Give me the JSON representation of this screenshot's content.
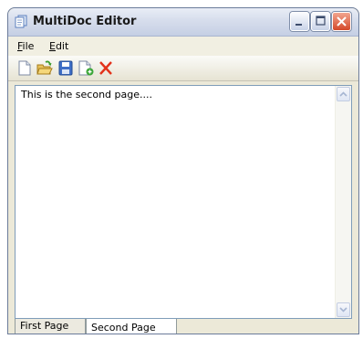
{
  "window": {
    "title": "MultiDoc Editor"
  },
  "menu": {
    "items": [
      {
        "mnemonic": "F",
        "rest": "ile"
      },
      {
        "mnemonic": "E",
        "rest": "dit"
      }
    ]
  },
  "toolbar": {
    "icons": [
      "new-icon",
      "open-icon",
      "save-icon",
      "new-page-icon",
      "delete-icon"
    ]
  },
  "editor": {
    "text": "This is the second page...."
  },
  "tabs": [
    {
      "label": "First Page"
    },
    {
      "label": "Second Page",
      "selected": true
    }
  ],
  "colors": {
    "selected_tab_accent": "#f3b64b",
    "delete_icon": "#e2321a"
  }
}
